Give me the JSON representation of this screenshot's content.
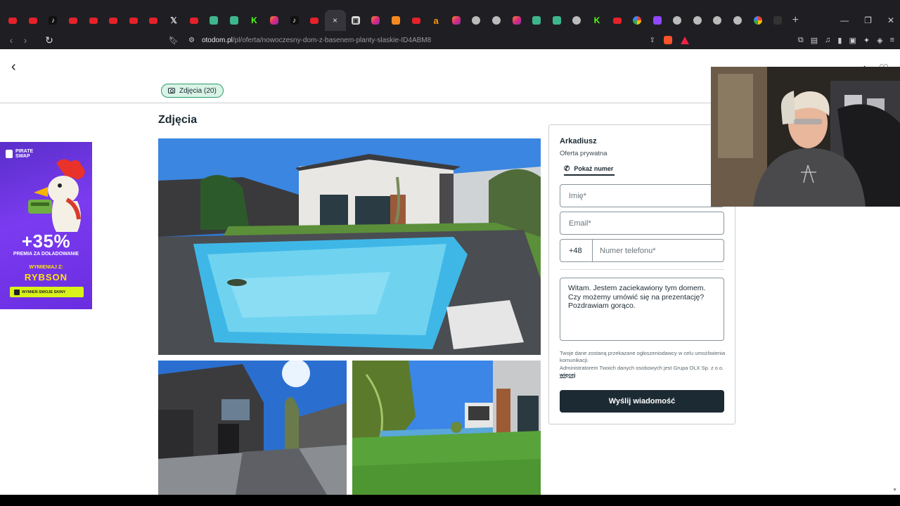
{
  "browser": {
    "tabs": [
      "yt",
      "yt",
      "tt",
      "yt",
      "yt",
      "yt",
      "yt",
      "yt",
      "x",
      "yt",
      "gr",
      "gr",
      "kk",
      "ig",
      "tt",
      "yt",
      "active",
      "sq",
      "ig",
      "or",
      "yt",
      "am",
      "ig",
      "gl",
      "gl",
      "ig",
      "gr",
      "gr",
      "gl",
      "kk",
      "yt",
      "go",
      "tw",
      "gl",
      "gl",
      "gl",
      "gl",
      "go",
      "dk"
    ],
    "tab_glyphs": {
      "tt": "♪",
      "x": "𝕏",
      "kk": "K",
      "am": "a",
      "sq": "▣"
    },
    "active_tab_close": "×",
    "new_tab": "+",
    "window_controls": [
      "—",
      "❐",
      "✕"
    ],
    "url_host": "otodom.pl",
    "url_path": "/pl/oferta/nowoczesny-dom-z-basenem-planty-slaskie-ID4ABM8"
  },
  "page": {
    "photos_button_label": "Zdjęcia (20)",
    "section_title": "Zdjęcia"
  },
  "ad": {
    "brand": "PIRATE SWAP",
    "percent": "+35%",
    "subtitle": "PREMIA ZA DOŁADOWANIE",
    "exchange_label": "WYMIENIAJ Z:",
    "code": "RYBSON",
    "cta": "WYMIEŃ SWOJE SKINY"
  },
  "contact": {
    "seller_name": "Arkadiusz",
    "seller_type": "Oferta prywatna",
    "show_phone_label": "Pokaż numer",
    "name_placeholder": "Imię*",
    "email_placeholder": "Email*",
    "phone_prefix": "+48",
    "phone_placeholder": "Numer telefonu*",
    "message": "Witam. Jestem zaciekawiony tym domem. Czy możemy umówić się na prezentację? Pozdrawiam gorąco.",
    "consent_1": "Twoje dane zostaną przekazane ogłoszeniodawcy w celu umożliwienia komunikacji.",
    "consent_2": "Administratorem Twoich danych osobowych jest Grupa OLX Sp. z o.o.",
    "consent_more": "więcej",
    "send_label": "Wyślij wiadomość"
  },
  "colors": {
    "brand_dark": "#1c2a33",
    "pill_bg": "#d9f3e6",
    "pill_border": "#2a9d6a",
    "ad_purple": "#6a2de0"
  }
}
